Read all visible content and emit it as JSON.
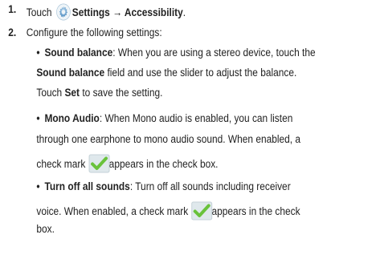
{
  "steps": [
    {
      "number": "1.",
      "text_before": "Touch",
      "icon": "settings-gear-icon",
      "bold_text": "Settings → Accessibility",
      "text_after": "."
    },
    {
      "number": "2.",
      "text": "Configure the following settings:"
    }
  ],
  "bullets": [
    {
      "term": "Sound balance",
      "lines": [
        ": When you are using a stereo device, touch the",
        "field and use the slider to adjust the balance.",
        "to save the setting."
      ],
      "term_inline": "Sound balance",
      "touch": "Touch",
      "set": "Set"
    },
    {
      "term": "Mono Audio",
      "lines": [
        ": When Mono audio is enabled, you can listen",
        "through one earphone to mono audio sound. When enabled, a",
        "check mark",
        "appears in the check box."
      ]
    },
    {
      "term": "Turn off all sounds",
      "lines": [
        ": Turn off all sounds including receiver",
        "voice. When enabled, a check mark",
        "appears in the check",
        "box."
      ]
    }
  ],
  "bullet_symbol": "•",
  "colors": {
    "text": "#222222",
    "check_box": "#dfe8ec",
    "check_mark": "#69c23b",
    "gear": "#4a90c8"
  }
}
